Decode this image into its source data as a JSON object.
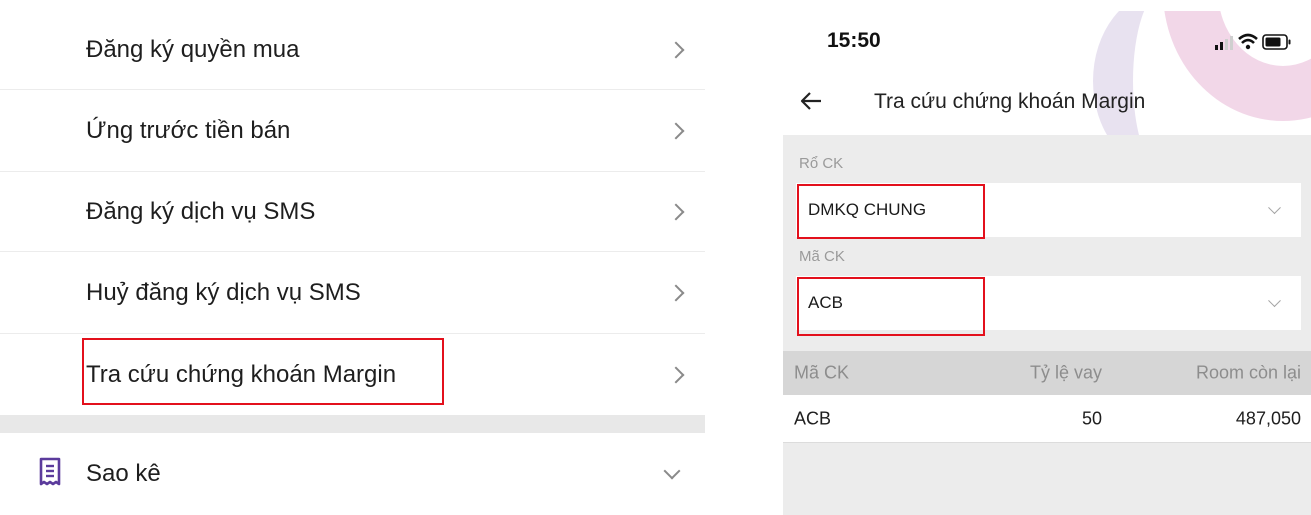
{
  "left_menu": {
    "items": [
      {
        "label": "Đăng ký quyền mua"
      },
      {
        "label": "Ứng trước tiền bán"
      },
      {
        "label": "Đăng ký dịch vụ SMS"
      },
      {
        "label": "Huỷ đăng ký dịch vụ SMS"
      },
      {
        "label": "Tra cứu chứng khoán Margin"
      }
    ],
    "section": {
      "label": "Sao kê",
      "icon": "receipt-icon"
    }
  },
  "phone": {
    "status_time": "15:50",
    "title": "Tra cứu chứng khoán Margin",
    "basket": {
      "label": "Rổ CK",
      "value": "DMKQ CHUNG"
    },
    "ticker": {
      "label": "Mã CK",
      "value": "ACB"
    },
    "table": {
      "headers": [
        "Mã CK",
        "Tỷ lệ vay",
        "Room còn lại"
      ],
      "rows": [
        [
          "ACB",
          "50",
          "487,050"
        ]
      ]
    }
  },
  "colors": {
    "highlight": "#e3101c",
    "icon_accent": "#5b3b9c"
  }
}
